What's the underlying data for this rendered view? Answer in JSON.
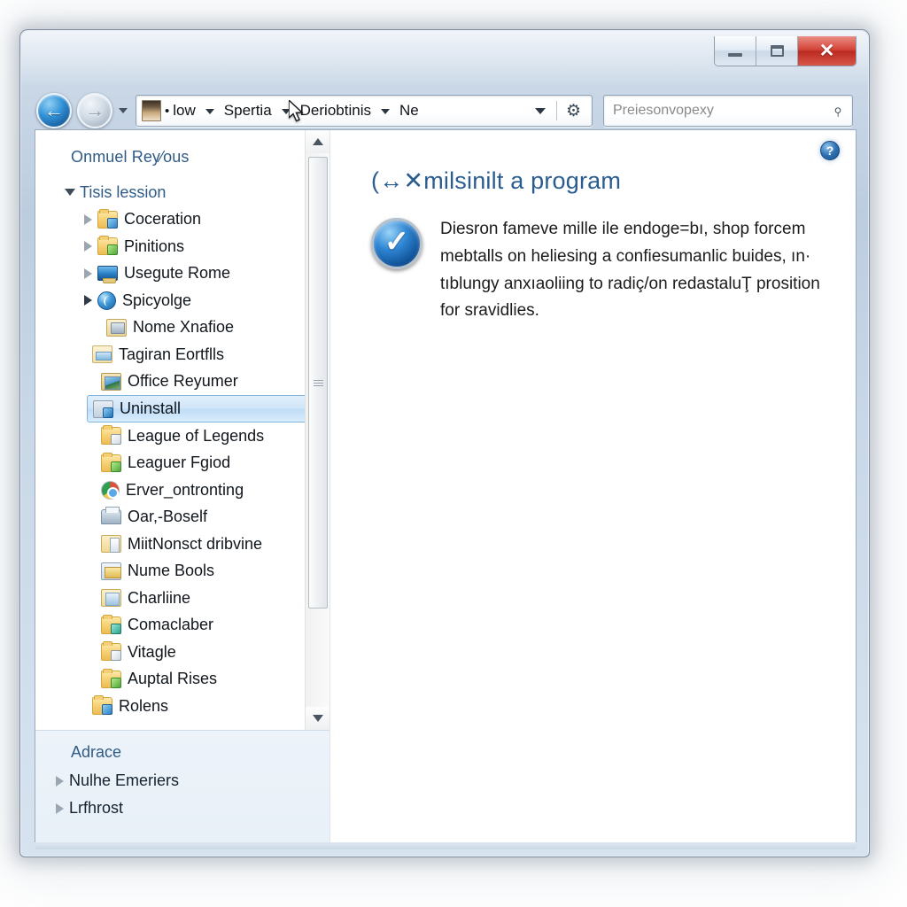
{
  "window": {
    "title": "",
    "controls": {
      "minimize_label": "Minimize",
      "restore_label": "Restore",
      "close_label": "✕"
    }
  },
  "toolbar": {
    "back_label": "←",
    "forward_label": "→",
    "history_caret": "",
    "refresh_icon": "⚙",
    "breadcrumbs": [
      {
        "label": "low"
      },
      {
        "label": "Spertia"
      },
      {
        "label": "Deriobtinis"
      },
      {
        "label": "Ne"
      }
    ],
    "crumb_bullet": "•"
  },
  "search": {
    "placeholder": "Preiesonvopexy",
    "value": "",
    "icon": "⌕"
  },
  "navpane": {
    "header": "Onmuel Rey⁄ous",
    "root": {
      "label": "Tisis lession"
    },
    "items": [
      {
        "label": "Coceration",
        "icon": "folder-blue",
        "indent": "lvl1",
        "expander": "right"
      },
      {
        "label": "Pinitions",
        "icon": "folder-green",
        "indent": "lvl1",
        "expander": "right"
      },
      {
        "label": "Usegute Rome",
        "icon": "monitor",
        "indent": "lvl1",
        "expander": "right"
      },
      {
        "label": "Spicyolge",
        "icon": "globe",
        "indent": "lvl1",
        "expander": "open"
      },
      {
        "label": "Nome Xnafioe",
        "icon": "laptop",
        "indent": "lvl2",
        "expander": "none"
      },
      {
        "label": "Tagiran Eortflls",
        "icon": "picfolder",
        "indent": "lvl-edge",
        "expander": "none"
      },
      {
        "label": "Office Reyumer",
        "icon": "photo",
        "indent": "lvl2b",
        "expander": "none"
      },
      {
        "label": "Uninstall",
        "icon": "uninstall",
        "indent": "selected",
        "expander": "none",
        "selected": true
      },
      {
        "label": "League of Legends",
        "icon": "folder-doc",
        "indent": "lvl2b",
        "expander": "none"
      },
      {
        "label": "Leaguer Fgiod",
        "icon": "folder-green",
        "indent": "lvl2b",
        "expander": "none"
      },
      {
        "label": "Erver_ontronting",
        "icon": "chrome",
        "indent": "lvl2b",
        "expander": "none"
      },
      {
        "label": "Oar,-Boself",
        "icon": "printer",
        "indent": "lvl2b",
        "expander": "none"
      },
      {
        "label": "MiitNonsct dribvine",
        "icon": "msfolder",
        "indent": "lvl2b",
        "expander": "none"
      },
      {
        "label": "Nume Bools",
        "icon": "cards",
        "indent": "lvl2b",
        "expander": "none"
      },
      {
        "label": "Charliine",
        "icon": "notepad",
        "indent": "lvl2b",
        "expander": "none"
      },
      {
        "label": "Comaclaber",
        "icon": "folder-teal",
        "indent": "lvl2b",
        "expander": "none"
      },
      {
        "label": "Vitagle",
        "icon": "folder-doc",
        "indent": "lvl2b",
        "expander": "none"
      },
      {
        "label": "Auptal Rises",
        "icon": "folder-green",
        "indent": "lvl2b",
        "expander": "none"
      },
      {
        "label": "Rolens",
        "icon": "folder-blue",
        "indent": "lvl-edge",
        "expander": "none"
      }
    ],
    "footer": {
      "header": "Adrace",
      "items": [
        {
          "label": "Nulhe Emeriers"
        },
        {
          "label": "Lrfhrost"
        }
      ]
    }
  },
  "content": {
    "heading": "(↔✕milsinilt a program",
    "paragraph": "Diesron fameve mille ile endoge=bı, shop forcem mebtalls on heliesing a confiesumanlic buides, ın· tıblungy anxıaoliing to radiç/on redastaluŢ prosition for sravidlies.",
    "help_icon": "?",
    "check_icon": "✓"
  },
  "colors": {
    "accent_blue": "#2a5c8f",
    "close_red": "#d4453a",
    "selection_blue": "#cfe6f9",
    "link_blue": "#2f5b86"
  }
}
